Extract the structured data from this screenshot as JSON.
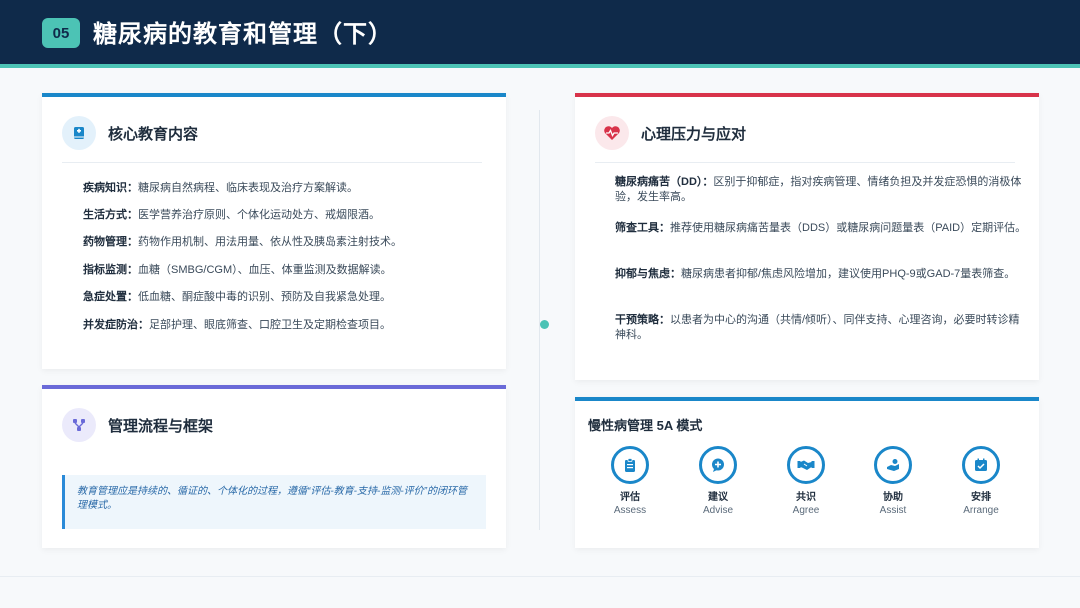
{
  "header": {
    "number": "05",
    "title": "糖尿病的教育和管理（下）"
  },
  "colors": {
    "header_bg": "#0f2a4a",
    "accent": "#4cc3b5",
    "card1_bar": "#1a87c9",
    "card2_bar": "#6a6ad8",
    "card3_bar": "#d8334a",
    "card4_bar": "#1a87c9"
  },
  "core_education": {
    "title": "核心教育内容",
    "icon": "book-icon",
    "items": [
      {
        "label": "疾病知识：",
        "text": "糖尿病自然病程、临床表现及治疗方案解读。"
      },
      {
        "label": "生活方式：",
        "text": "医学营养治疗原则、个体化运动处方、戒烟限酒。"
      },
      {
        "label": "药物管理：",
        "text": "药物作用机制、用法用量、依从性及胰岛素注射技术。"
      },
      {
        "label": "指标监测：",
        "text": "血糖（SMBG/CGM）、血压、体重监测及数据解读。"
      },
      {
        "label": "急症处置：",
        "text": "低血糖、酮症酸中毒的识别、预防及自我紧急处理。"
      },
      {
        "label": "并发症防治：",
        "text": "足部护理、眼底筛查、口腔卫生及定期检查项目。"
      }
    ]
  },
  "framework": {
    "title": "管理流程与框架",
    "icon": "flow-icon",
    "quote": "教育管理应是持续的、循证的、个体化的过程，遵循“评估-教育-支持-监测-评价”的闭环管理模式。"
  },
  "psychology": {
    "title": "心理压力与应对",
    "icon": "heart-pulse-icon",
    "items": [
      {
        "label": "糖尿病痛苦（DD）：",
        "text": "区别于抑郁症，指对疾病管理、情绪负担及并发症恐惧的消极体验，发生率高。"
      },
      {
        "label": "筛查工具：",
        "text": "推荐使用糖尿病痛苦量表（DDS）或糖尿病问题量表（PAID）定期评估。"
      },
      {
        "label": "抑郁与焦虑：",
        "text": "糖尿病患者抑郁/焦虑风险增加，建议使用PHQ-9或GAD-7量表筛查。"
      },
      {
        "label": "干预策略：",
        "text": "以患者为中心的沟通（共情/倾听）、同伴支持、心理咨询，必要时转诊精神科。"
      }
    ]
  },
  "model_5a": {
    "title": "慢性病管理 5A 模式",
    "steps": [
      {
        "zh": "评估",
        "en": "Assess",
        "icon": "clipboard-icon"
      },
      {
        "zh": "建议",
        "en": "Advise",
        "icon": "chat-icon"
      },
      {
        "zh": "共识",
        "en": "Agree",
        "icon": "handshake-icon"
      },
      {
        "zh": "协助",
        "en": "Assist",
        "icon": "helping-hand-icon"
      },
      {
        "zh": "安排",
        "en": "Arrange",
        "icon": "calendar-check-icon"
      }
    ]
  }
}
